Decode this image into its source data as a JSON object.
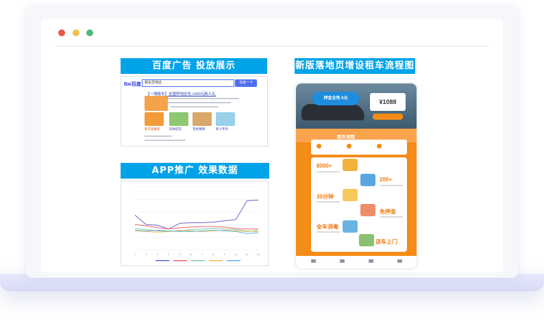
{
  "window": {
    "controls": [
      {
        "name": "close",
        "color": "#e8574a"
      },
      {
        "name": "minimize",
        "color": "#f1c14d"
      },
      {
        "name": "maximize",
        "color": "#4fb87a"
      }
    ]
  },
  "sections": {
    "baidu": {
      "title": "百度广告 投放展示",
      "search_value": "租车异地还",
      "search_button": "百度一下",
      "logo_text": "Bai百度",
      "ad_title": "【一嗨租车】全国异地还车,1000元新人礼",
      "thumb_labels": [
        "新车型推荐",
        "异地还车",
        "无忧保障",
        "新人专享"
      ]
    },
    "app": {
      "title": "APP推广 效果数据"
    },
    "landing": {
      "title": "新版落地页增设租车流程图",
      "speech_text": "押金全免 0元",
      "price": "¥1088",
      "flow_title": "租车流程",
      "features": [
        "8000+",
        "200+",
        "30分钟",
        "免押金",
        "全车消毒",
        "送车上门"
      ]
    }
  },
  "chart_data": {
    "type": "line",
    "title": "",
    "xlabel": "",
    "ylabel": "",
    "categories": [
      "1",
      "2",
      "3",
      "4",
      "5",
      "6",
      "7",
      "8",
      "9",
      "10",
      "11",
      "12"
    ],
    "ylim": [
      0,
      100
    ],
    "grid": true,
    "series": [
      {
        "color": "#6a62c9",
        "values": [
          55,
          40,
          39,
          33,
          42,
          43,
          43,
          44,
          46,
          48,
          78,
          79
        ]
      },
      {
        "color": "#e8606f",
        "values": [
          40,
          38,
          35,
          33,
          35,
          36,
          37,
          37,
          36,
          34,
          33,
          33
        ]
      },
      {
        "color": "#7fc6a4",
        "values": [
          34,
          32,
          30,
          29,
          30,
          32,
          33,
          34,
          33,
          32,
          30,
          29
        ]
      },
      {
        "color": "#f2b84b",
        "values": [
          30,
          29,
          28,
          29,
          31,
          30,
          29,
          30,
          31,
          30,
          29,
          31
        ]
      },
      {
        "color": "#5bb4e5",
        "values": [
          31,
          30,
          31,
          30,
          29,
          29,
          30,
          31,
          30,
          29,
          26,
          27
        ]
      }
    ]
  }
}
